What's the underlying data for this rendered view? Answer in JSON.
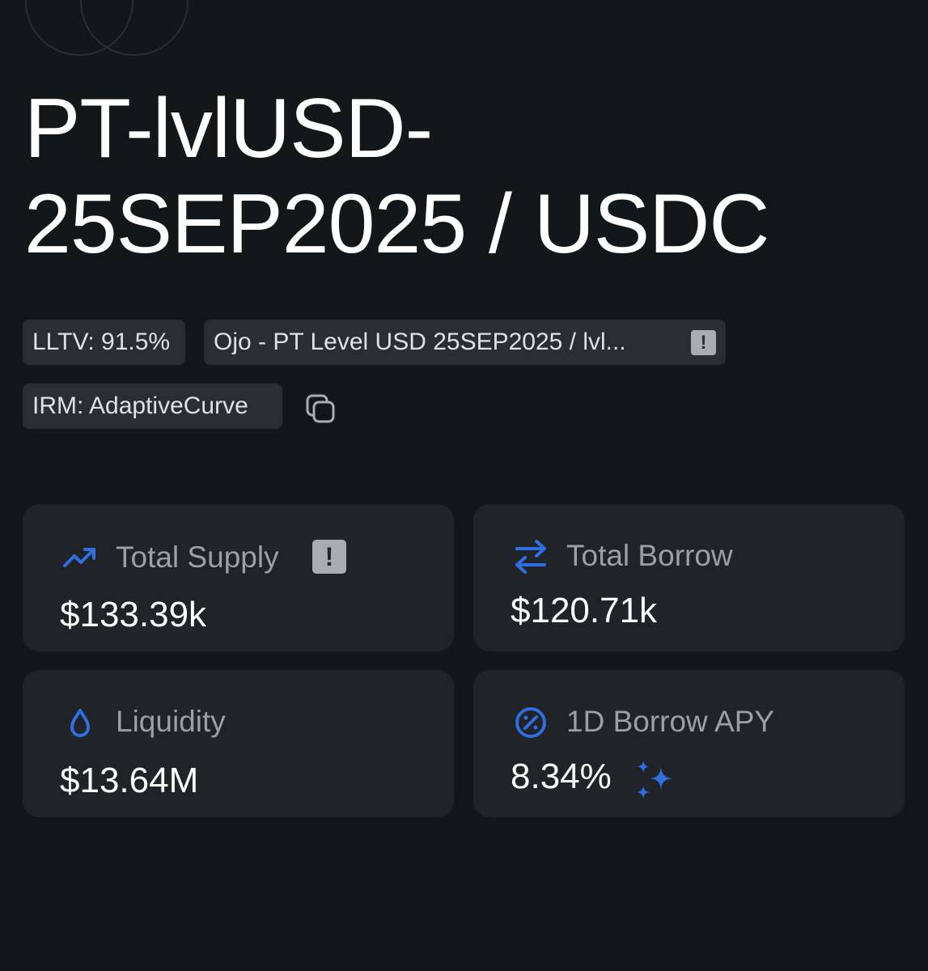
{
  "market": {
    "title": "PT-lvlUSD-25SEP2025 / USDC",
    "title_line1": "PT-lvlUSD-",
    "title_line2": "25SEP2025 / USDC"
  },
  "chips": {
    "lltv": "LLTV: 91.5%",
    "oracle": "Ojo - PT Level USD 25SEP2025 / lvl...",
    "irm": "IRM: AdaptiveCurve"
  },
  "stats": {
    "total_supply": {
      "label": "Total Supply",
      "value": "$133.39k",
      "icon": "trending-up-icon"
    },
    "total_borrow": {
      "label": "Total Borrow",
      "value": "$120.71k",
      "icon": "swap-arrows-icon"
    },
    "liquidity": {
      "label": "Liquidity",
      "value": "$13.64M",
      "icon": "droplet-icon"
    },
    "borrow_apy": {
      "label": "1D Borrow APY",
      "value": "8.34%",
      "icon": "percent-circle-icon"
    }
  },
  "colors": {
    "background": "#14171a",
    "card": "#202327",
    "chip": "#2a2d31",
    "accent": "#2f6fe0",
    "muted_text": "#9aa0a6"
  }
}
